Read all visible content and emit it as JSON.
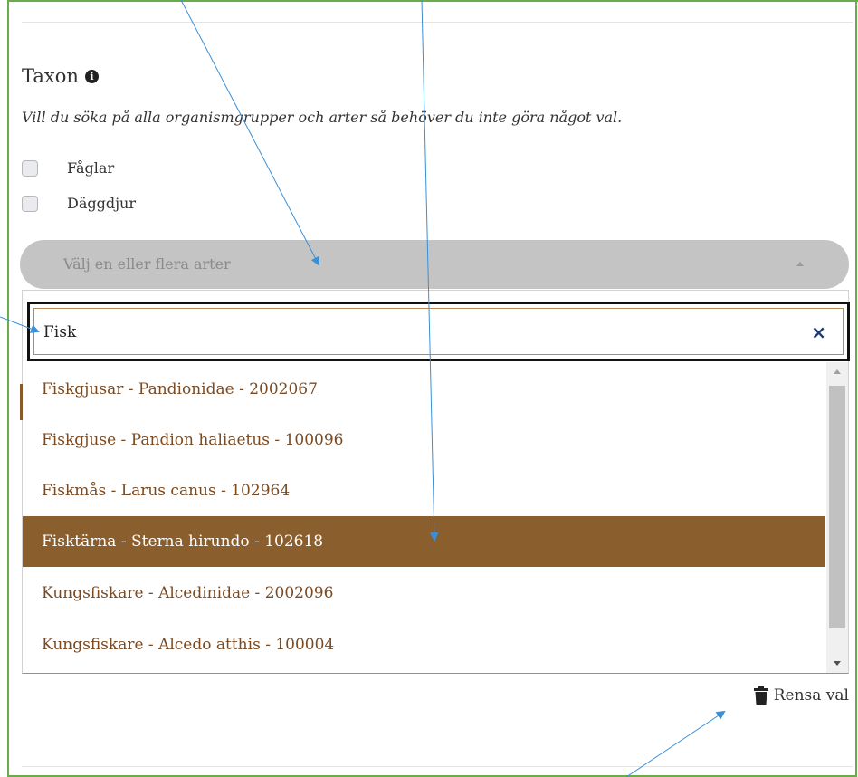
{
  "section": {
    "title": "Taxon",
    "hint": "Vill du söka på alla organismgrupper och arter så behöver du inte göra något val."
  },
  "checkboxes": [
    {
      "label": "Fåglar",
      "checked": false
    },
    {
      "label": "Däggdjur",
      "checked": false
    }
  ],
  "species_select": {
    "placeholder": "Välj en eller flera arter"
  },
  "search": {
    "value": "Fisk"
  },
  "results": [
    {
      "label": "Fiskgjusar - Pandionidae - 2002067",
      "highlighted": false
    },
    {
      "label": "Fiskgjuse - Pandion haliaetus - 100096",
      "highlighted": false
    },
    {
      "label": "Fiskmås - Larus canus - 102964",
      "highlighted": false
    },
    {
      "label": "Fisktärna - Sterna hirundo - 102618",
      "highlighted": true
    },
    {
      "label": "Kungsfiskare - Alcedinidae - 2002096",
      "highlighted": false
    },
    {
      "label": "Kungsfiskare - Alcedo atthis - 100004",
      "highlighted": false
    }
  ],
  "actions": {
    "clear_selection": "Rensa val"
  },
  "colors": {
    "panel_border": "#6aab4b",
    "highlight_bg": "#8b5e2e",
    "result_text": "#7a4a22",
    "annotation_arrow": "#3a8fd6"
  },
  "icons": [
    "info-icon",
    "clear-icon",
    "trash-icon",
    "caret-up-icon"
  ]
}
